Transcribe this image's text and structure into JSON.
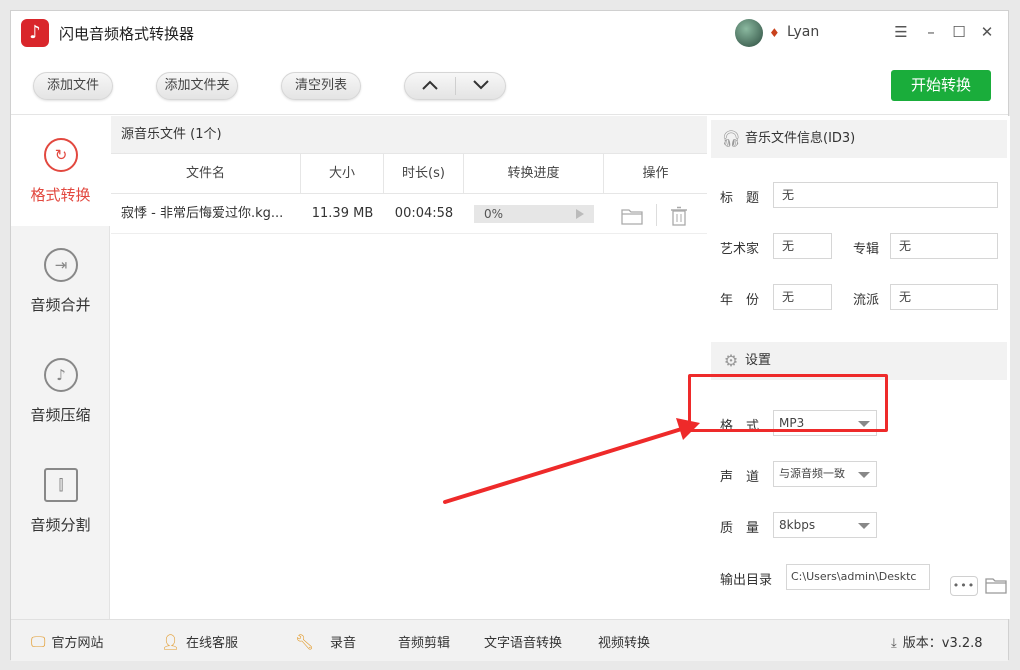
{
  "window": {
    "title": "闪电音频格式转换器",
    "user_name": "Lyan"
  },
  "toolbar": {
    "add_file": "添加文件",
    "add_folder": "添加文件夹",
    "clear_list": "清空列表",
    "move_up": "∧",
    "move_down": "∨",
    "start": "开始转换"
  },
  "sidebar": {
    "items": [
      {
        "label": "格式转换",
        "icon": "refresh-icon",
        "active": true
      },
      {
        "label": "音频合并",
        "icon": "merge-icon",
        "active": false
      },
      {
        "label": "音频压缩",
        "icon": "music-note-icon",
        "active": false
      },
      {
        "label": "音频分割",
        "icon": "split-icon",
        "active": false
      }
    ]
  },
  "filelist": {
    "header": "源音乐文件 (1个)",
    "columns": [
      "文件名",
      "大小",
      "时长(s)",
      "转换进度",
      "操作"
    ],
    "rows": [
      {
        "name": "寂悸 - 非常后悔爱过你.kg...",
        "size": "11.39 MB",
        "duration": "00:04:58",
        "progress_text": "0%",
        "progress": 0
      }
    ]
  },
  "id3": {
    "heading": "音乐文件信息(ID3)",
    "title_label": "标　题",
    "title_value": "无",
    "artist_label": "艺术家",
    "artist_value": "无",
    "album_label": "专辑",
    "album_value": "无",
    "year_label": "年　份",
    "year_value": "无",
    "genre_label": "流派",
    "genre_value": "无"
  },
  "settings": {
    "heading": "设置",
    "format_label": "格　式",
    "format_value": "MP3",
    "channel_label": "声　道",
    "channel_value": "与源音频一致",
    "quality_label": "质　量",
    "quality_value": "8kbps",
    "output_label": "输出目录",
    "output_value": "C:\\Users\\admin\\Desktc",
    "browse_label": "•••"
  },
  "footer": {
    "website": "官方网站",
    "support": "在线客服",
    "record": "录音",
    "audio_edit": "音频剪辑",
    "tts": "文字语音转换",
    "video_convert": "视频转换",
    "version": "版本：v3.2.8"
  },
  "colors": {
    "accent_red": "#e2483f",
    "start_green": "#1aad3b",
    "highlight_red": "#ee2a2a"
  }
}
